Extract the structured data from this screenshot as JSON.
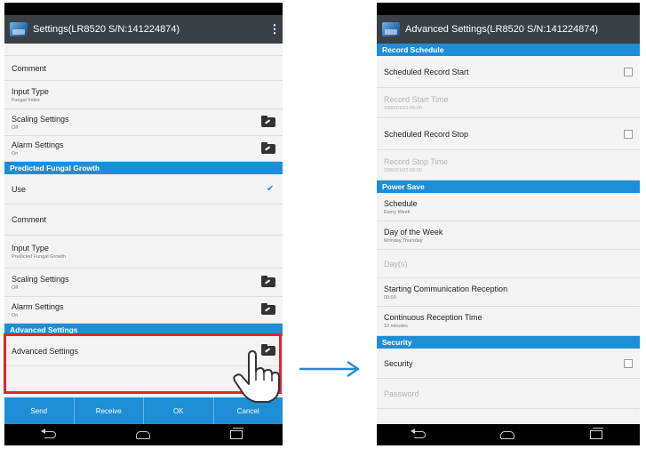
{
  "left_screen": {
    "title": "Settings(LR8520 S/N:141224874)",
    "rows_top": [
      {
        "label": "Comment",
        "sub": ""
      },
      {
        "label": "Input Type",
        "sub": "Fungal Index"
      },
      {
        "label": "Scaling Settings",
        "sub": "Off"
      },
      {
        "label": "Alarm Settings",
        "sub": "On"
      }
    ],
    "section_fungal": "Predicted Fungal Growth",
    "fungal_rows": [
      {
        "label": "Use",
        "sub": ""
      },
      {
        "label": "Comment",
        "sub": ""
      },
      {
        "label": "Input Type",
        "sub": "Predicted Fungal Growth"
      },
      {
        "label": "Scaling Settings",
        "sub": "Off"
      },
      {
        "label": "Alarm Settings",
        "sub": "On"
      }
    ],
    "section_advanced": "Advanced Settings",
    "advanced_row": "Advanced Settings",
    "buttons": [
      "Send",
      "Receive",
      "OK",
      "Cancel"
    ]
  },
  "right_screen": {
    "title": "Advanced Settings(LR8520 S/N:141224874)",
    "section_record": "Record Schedule",
    "scheduled_record_start": "Scheduled Record Start",
    "record_start_time": {
      "label": "Record Start Time",
      "sub": "2000/01/01 00:00"
    },
    "scheduled_record_stop": "Scheduled Record Stop",
    "record_stop_time": {
      "label": "Record Stop Time",
      "sub": "2000/01/02 00:00"
    },
    "section_power": "Power Save",
    "schedule": {
      "label": "Schedule",
      "sub": "Every Week"
    },
    "day_of_week": {
      "label": "Day of the Week",
      "sub": "Monday,Thursday"
    },
    "days": {
      "label": "Day(s)",
      "sub": ""
    },
    "starting_comm": {
      "label": "Starting Communication Reception",
      "sub": "09:00"
    },
    "continuous_time": {
      "label": "Continuous Reception Time",
      "sub": "10 minutes"
    },
    "section_security": "Security",
    "security": "Security",
    "password": "Password"
  },
  "colors": {
    "accent": "#1e8ed6",
    "highlight": "#e3242b",
    "appbar": "#3b4046"
  }
}
